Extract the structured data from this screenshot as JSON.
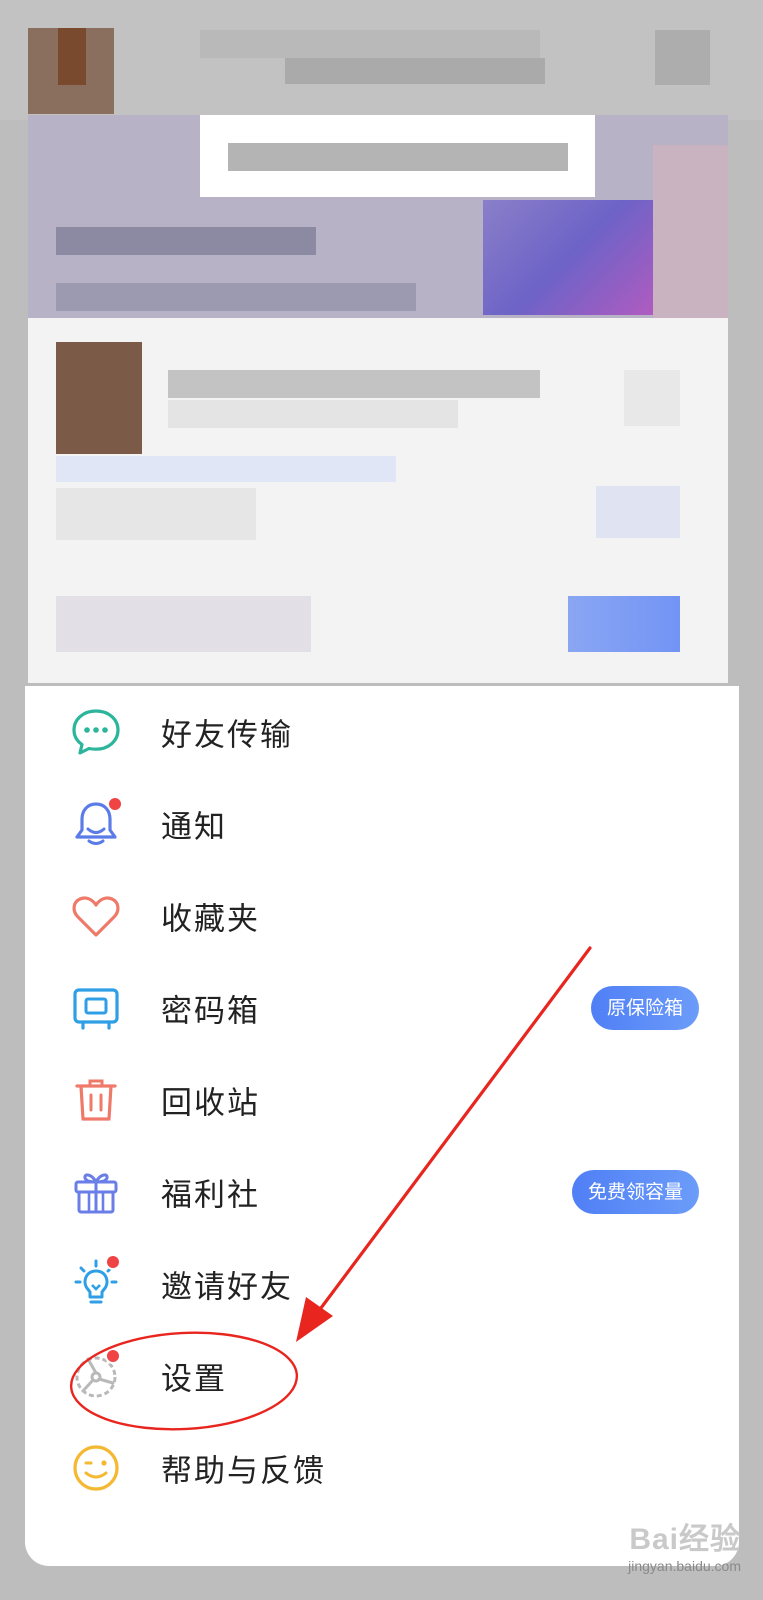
{
  "menu": {
    "items": [
      {
        "label": "好友传输",
        "icon": "chat-bubble-icon",
        "dot": false,
        "badge": ""
      },
      {
        "label": "通知",
        "icon": "bell-icon",
        "dot": true,
        "badge": ""
      },
      {
        "label": "收藏夹",
        "icon": "heart-icon",
        "dot": false,
        "badge": ""
      },
      {
        "label": "密码箱",
        "icon": "safe-box-icon",
        "dot": false,
        "badge": "原保险箱"
      },
      {
        "label": "回收站",
        "icon": "trash-icon",
        "dot": false,
        "badge": ""
      },
      {
        "label": "福利社",
        "icon": "gift-icon",
        "dot": false,
        "badge": "免费领容量"
      },
      {
        "label": "邀请好友",
        "icon": "lightbulb-icon",
        "dot": true,
        "badge": ""
      },
      {
        "label": "设置",
        "icon": "gear-icon",
        "dot": true,
        "badge": ""
      },
      {
        "label": "帮助与反馈",
        "icon": "smiley-icon",
        "dot": false,
        "badge": ""
      }
    ]
  },
  "colors": {
    "accent": "#5a8ef7",
    "dot": "#f04343",
    "annotation": "#e8261f",
    "chat_icon": "#2bb59a",
    "bell_icon": "#5b7be8",
    "heart_icon": "#ef7a6a",
    "safe_icon": "#2e9fe6",
    "trash_icon": "#ef7a6a",
    "gift_icon": "#6a7ee8",
    "bulb_icon": "#2e9fe6",
    "gear_icon": "#b9b9b9",
    "smiley_icon": "#f5b832"
  },
  "watermark": {
    "logo": "Bai经验",
    "url": "jingyan.baidu.com"
  }
}
